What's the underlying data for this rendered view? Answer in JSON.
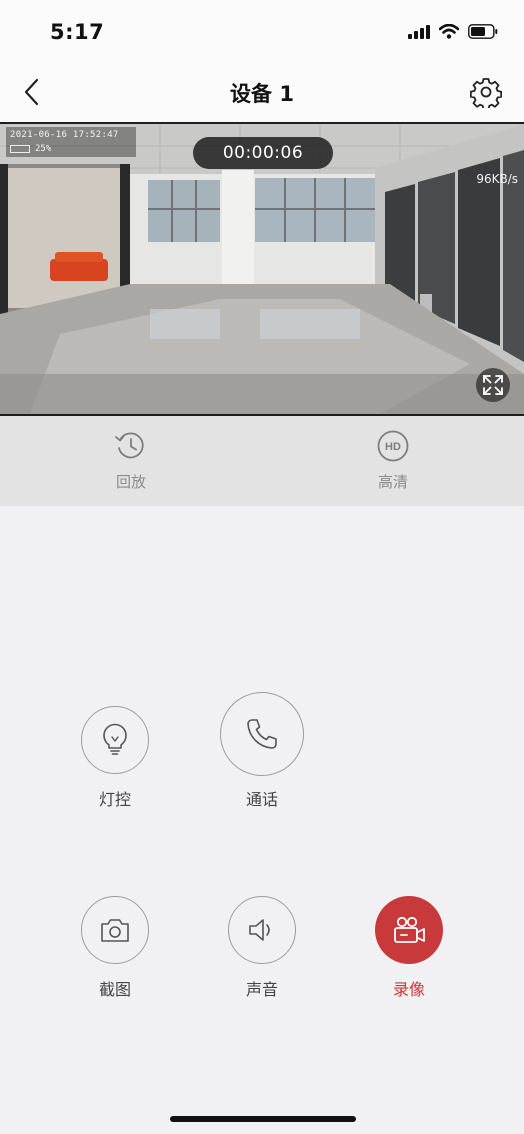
{
  "status_bar": {
    "time": "5:17"
  },
  "nav": {
    "title": "设备 1",
    "back_icon": "chevron-left-icon",
    "settings_icon": "gear-icon"
  },
  "video": {
    "osd_datetime": "2021-06-16 17:52:47",
    "osd_battery": "25%",
    "timer": "00:00:06",
    "bitrate": "96KB/s"
  },
  "quick_bar": {
    "playback_label": "回放",
    "quality_label": "高清",
    "quality_badge": "HD"
  },
  "controls": {
    "light_label": "灯控",
    "call_label": "通话",
    "screenshot_label": "截图",
    "sound_label": "声音",
    "record_label": "录像"
  },
  "colors": {
    "accent": "#c7393a",
    "background": "#f1f0f3",
    "quick_bar": "#e3e3e3"
  }
}
